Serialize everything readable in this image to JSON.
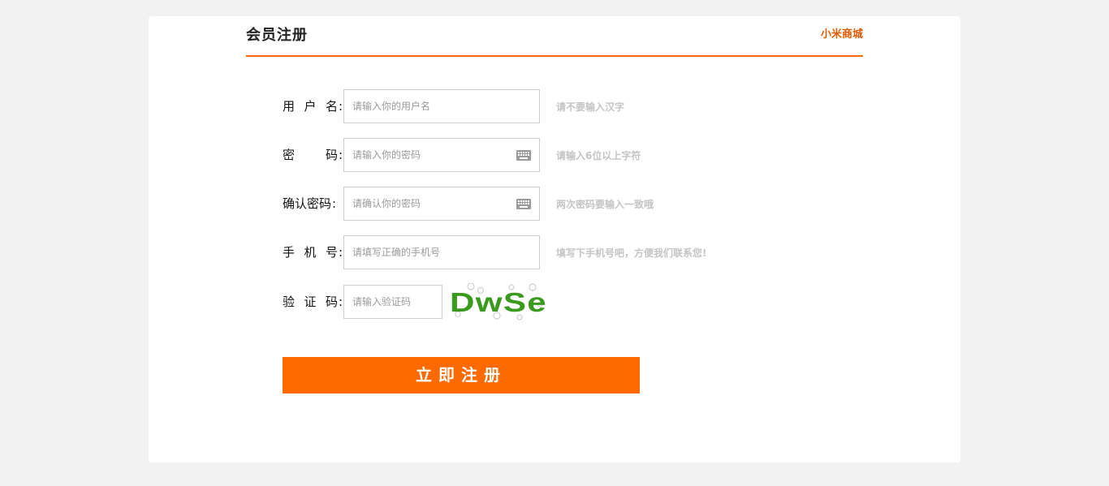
{
  "header": {
    "title": "会员注册",
    "brand_link": "小米商城"
  },
  "form": {
    "username": {
      "label_chars": [
        "用",
        "户",
        "名"
      ],
      "colon": ":",
      "placeholder": "请输入你的用户名",
      "value": "",
      "hint": "请不要输入汉字"
    },
    "password": {
      "label_chars": [
        "密",
        "码"
      ],
      "colon": ":",
      "placeholder": "请输入你的密码",
      "value": "",
      "icon": "keyboard-icon",
      "hint": "请输入6位以上字符"
    },
    "confirm_password": {
      "label": "确认密码",
      "colon": ":",
      "placeholder": "请确认你的密码",
      "value": "",
      "icon": "keyboard-icon",
      "hint": "两次密码要输入一致哦"
    },
    "phone": {
      "label_chars": [
        "手",
        "机",
        "号"
      ],
      "colon": ":",
      "placeholder": "请填写正确的手机号",
      "value": "",
      "hint": "填写下手机号吧，方便我们联系您!"
    },
    "captcha": {
      "label_chars": [
        "验",
        "证",
        "码"
      ],
      "colon": ":",
      "placeholder": "请输入验证码",
      "value": "",
      "image_text": "DwSe"
    },
    "submit_label": "立即注册"
  },
  "colors": {
    "accent": "#ff6a00",
    "brand_text": "#e05a00",
    "hint_text": "#c4c4c4",
    "captcha_text": "#3a9a1e",
    "background": "#f2f2f2"
  }
}
